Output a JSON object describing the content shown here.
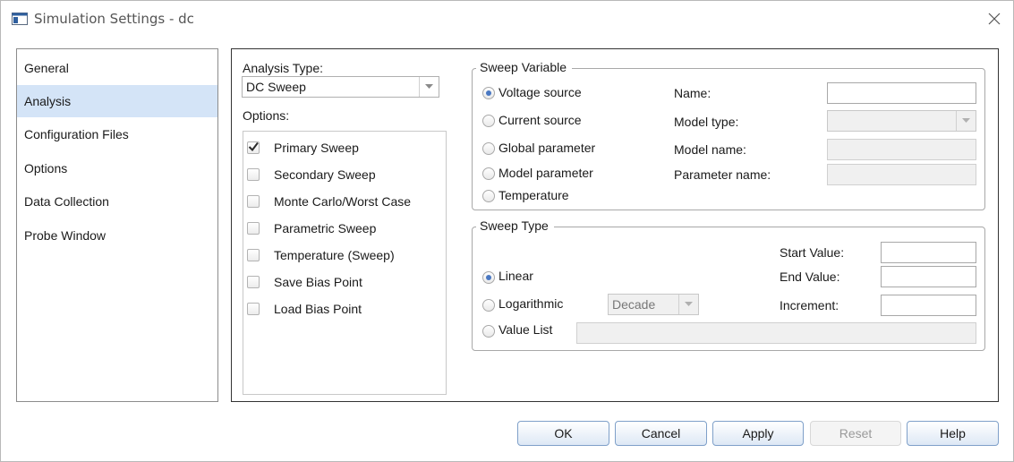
{
  "window": {
    "title": "Simulation Settings - dc"
  },
  "nav": {
    "items": [
      {
        "label": "General"
      },
      {
        "label": "Analysis"
      },
      {
        "label": "Configuration Files"
      },
      {
        "label": "Options"
      },
      {
        "label": "Data Collection"
      },
      {
        "label": "Probe Window"
      }
    ],
    "selected": "Analysis"
  },
  "analysis": {
    "type_label": "Analysis Type:",
    "type_value": "DC Sweep",
    "options_label": "Options:",
    "options": [
      {
        "label": "Primary Sweep",
        "checked": true
      },
      {
        "label": "Secondary Sweep",
        "checked": false
      },
      {
        "label": "Monte Carlo/Worst Case",
        "checked": false
      },
      {
        "label": "Parametric Sweep",
        "checked": false
      },
      {
        "label": "Temperature (Sweep)",
        "checked": false
      },
      {
        "label": "Save Bias Point",
        "checked": false
      },
      {
        "label": "Load Bias Point",
        "checked": false
      }
    ]
  },
  "sweep_variable": {
    "title": "Sweep Variable",
    "radios": [
      {
        "label": "Voltage source",
        "checked": true
      },
      {
        "label": "Current source",
        "checked": false
      },
      {
        "label": "Global parameter",
        "checked": false
      },
      {
        "label": "Model parameter",
        "checked": false
      },
      {
        "label": "Temperature",
        "checked": false
      }
    ],
    "name_label": "Name:",
    "name_value": "",
    "model_type_label": "Model type:",
    "model_type_value": "",
    "model_name_label": "Model name:",
    "model_name_value": "",
    "parameter_name_label": "Parameter name:",
    "parameter_name_value": ""
  },
  "sweep_type": {
    "title": "Sweep Type",
    "linear_label": "Linear",
    "linear_checked": true,
    "logarithmic_label": "Logarithmic",
    "log_scale_value": "Decade",
    "value_list_label": "Value List",
    "value_list_value": "",
    "start_value_label": "Start Value:",
    "start_value": "",
    "end_value_label": "End Value:",
    "end_value": "",
    "increment_label": "Increment:",
    "increment_value": ""
  },
  "buttons": {
    "ok": "OK",
    "cancel": "Cancel",
    "apply": "Apply",
    "reset": "Reset",
    "help": "Help"
  },
  "colors": {
    "selection": "#d4e4f7",
    "radio_dot": "#4a78c2",
    "button_border": "#7fa0c9"
  }
}
